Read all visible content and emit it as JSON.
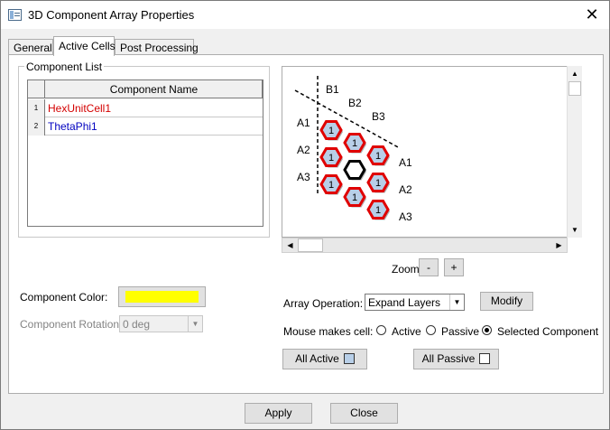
{
  "window": {
    "title": "3D Component Array Properties",
    "close_glyph": "✕"
  },
  "tabs": [
    {
      "label": "General"
    },
    {
      "label": "Active Cells"
    },
    {
      "label": "Post Processing"
    }
  ],
  "component_list": {
    "group_label": "Component List",
    "column_header": "Component Name",
    "rows": [
      {
        "num": "1",
        "name": "HexUnitCell1",
        "color": "#d40000"
      },
      {
        "num": "2",
        "name": "ThetaPhi1",
        "color": "#0000c0"
      }
    ]
  },
  "diagram": {
    "b_labels": [
      "B1",
      "B2",
      "B3"
    ],
    "a_left_labels": [
      "A1",
      "A2",
      "A3"
    ],
    "a_right_labels": [
      "A1",
      "A2",
      "A3"
    ],
    "cell_value": "1",
    "cell_fill": "#b8cfe8",
    "cell_border": "#e00000"
  },
  "zoom": {
    "label": "Zoom",
    "minus": "-",
    "plus": "+"
  },
  "component_color": {
    "label": "Component Color:",
    "value": "#ffff00"
  },
  "component_rotation": {
    "label": "Component Rotation:",
    "value": "0 deg"
  },
  "array_operation": {
    "label": "Array Operation:",
    "value": "Expand Layers",
    "modify_label": "Modify"
  },
  "mouse_mode": {
    "label": "Mouse makes cell:",
    "options": [
      {
        "label": "Active",
        "checked": false
      },
      {
        "label": "Passive",
        "checked": false
      },
      {
        "label": "Selected Component",
        "checked": true
      }
    ]
  },
  "all_active": {
    "label": "All Active",
    "swatch": "#b8cfe8"
  },
  "all_passive": {
    "label": "All Passive",
    "swatch": "#ffffff"
  },
  "footer": {
    "apply_label": "Apply",
    "close_label": "Close"
  }
}
